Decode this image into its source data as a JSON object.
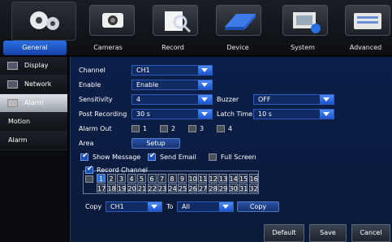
{
  "tabs": [
    {
      "label": "General"
    },
    {
      "label": "Cameras"
    },
    {
      "label": "Record"
    },
    {
      "label": "Device"
    },
    {
      "label": "System"
    },
    {
      "label": "Advanced"
    }
  ],
  "sidebar": {
    "items": [
      {
        "label": "Display"
      },
      {
        "label": "Network"
      },
      {
        "label": "Alarm"
      },
      {
        "label": "Motion"
      },
      {
        "label": "Alarm"
      }
    ]
  },
  "form": {
    "channel_label": "Channel",
    "channel_value": "CH1",
    "enable_label": "Enable",
    "enable_value": "Enable",
    "sensitivity_label": "Sensitivity",
    "sensitivity_value": "4",
    "buzzer_label": "Buzzer",
    "buzzer_value": "OFF",
    "post_recording_label": "Post Recording",
    "post_recording_value": "30 s",
    "latch_time_label": "Latch Time",
    "latch_time_value": "10 s",
    "alarm_out_label": "Alarm Out",
    "alarm_out_options": [
      "1",
      "2",
      "3",
      "4"
    ],
    "area_label": "Area",
    "setup_label": "Setup",
    "show_message_label": "Show Message",
    "send_email_label": "Send Email",
    "full_screen_label": "Full Screen",
    "record_channel_label": "Record Channel",
    "channels": [
      "1",
      "2",
      "3",
      "4",
      "5",
      "6",
      "7",
      "8",
      "9",
      "10",
      "11",
      "12",
      "13",
      "14",
      "15",
      "16",
      "17",
      "18",
      "19",
      "20",
      "21",
      "22",
      "23",
      "24",
      "25",
      "26",
      "27",
      "28",
      "29",
      "30",
      "31",
      "32"
    ],
    "copy_label": "Copy",
    "copy_from_value": "CH1",
    "to_label": "To",
    "copy_to_value": "All",
    "copy_button_label": "Copy"
  },
  "footer": {
    "default_label": "Default",
    "save_label": "Save",
    "cancel_label": "Cancel"
  },
  "colors": {
    "accent": "#2a6fe0",
    "panel_bg": "#0b1f49"
  }
}
